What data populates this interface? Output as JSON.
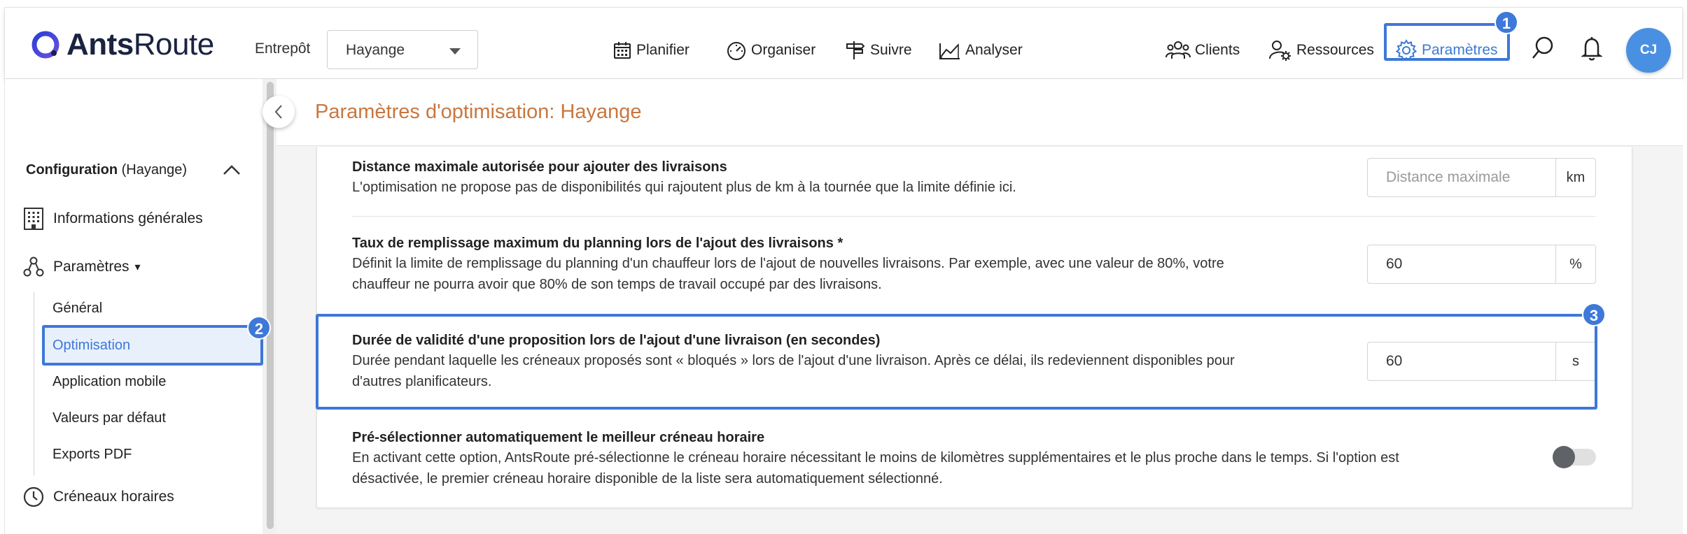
{
  "header": {
    "logo": {
      "bold": "Ants",
      "light": "Route"
    },
    "warehouse_label": "Entrepôt",
    "warehouse_value": "Hayange",
    "nav": [
      {
        "label": "Planifier",
        "icon": "calendar-icon"
      },
      {
        "label": "Organiser",
        "icon": "speedometer-icon"
      },
      {
        "label": "Suivre",
        "icon": "signpost-icon"
      },
      {
        "label": "Analyser",
        "icon": "chart-icon"
      }
    ],
    "right_nav": [
      {
        "label": "Clients",
        "icon": "users-icon"
      },
      {
        "label": "Ressources",
        "icon": "user-gear-icon"
      },
      {
        "label": "Paramètres",
        "icon": "gear-icon",
        "active": true
      }
    ],
    "avatar_initials": "CJ"
  },
  "badges": [
    "1",
    "2",
    "3"
  ],
  "sidebar": {
    "config_title_bold": "Configuration",
    "config_title_rest": " (Hayange)",
    "items": [
      {
        "label": "Informations générales",
        "icon": "building-icon"
      },
      {
        "label": "Paramètres",
        "icon": "nodes-icon",
        "suffix": "▾"
      },
      {
        "label": "Créneaux horaires",
        "icon": "clock-icon"
      }
    ],
    "subitems": [
      "Général",
      "Optimisation",
      "Application mobile",
      "Valeurs par défaut",
      "Exports PDF"
    ],
    "active_subitem": "Optimisation"
  },
  "page": {
    "title": "Paramètres d'optimisation: Hayange"
  },
  "settings": [
    {
      "title": "Distance maximale autorisée pour ajouter des livraisons",
      "desc": [
        "L'optimisation ne propose pas de disponibilités qui rajoutent plus de km à la tournée que la limite définie ici."
      ],
      "placeholder": "Distance maximale",
      "value": "",
      "unit": "km"
    },
    {
      "title": "Taux de remplissage maximum du planning lors de l'ajout des livraisons *",
      "desc": [
        "Définit la limite de remplissage du planning d'un chauffeur lors de l'ajout de nouvelles livraisons. Par exemple, avec une valeur de 80%, votre",
        "chauffeur ne pourra avoir que 80% de son temps de travail occupé par des livraisons."
      ],
      "value": "60",
      "unit": "%"
    },
    {
      "title": "Durée de validité d'une proposition lors de l'ajout d'une livraison (en secondes)",
      "desc": [
        "Durée pendant laquelle les créneaux proposés sont « bloqués » lors de l'ajout d'une livraison. Après ce délai, ils redeviennent disponibles pour",
        "d'autres planificateurs."
      ],
      "value": "60",
      "unit": "s"
    },
    {
      "title": "Pré-sélectionner automatiquement le meilleur créneau horaire",
      "desc": [
        "En activant cette option, AntsRoute pré-sélectionne le créneau horaire nécessitant le moins de kilomètres supplémentaires et le plus proche dans le temps. Si l'option est",
        "désactivée, le premier créneau horaire disponible de la liste sera automatiquement sélectionné."
      ],
      "toggle": false
    }
  ],
  "colors": {
    "accent": "#3e78d8",
    "title_orange": "#c8773f",
    "avatar": "#4a90e2"
  }
}
